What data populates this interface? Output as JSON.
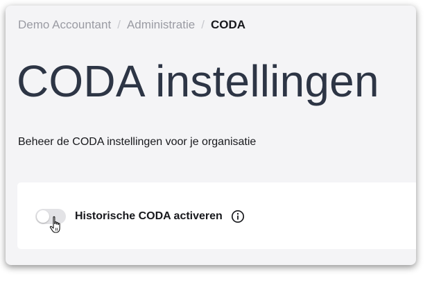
{
  "breadcrumb": {
    "items": [
      "Demo Accountant",
      "Administratie"
    ],
    "separator": "/",
    "current": "CODA"
  },
  "page": {
    "title": "CODA instellingen",
    "subtitle": "Beheer de CODA instellingen voor je organisatie"
  },
  "settings": {
    "historic_coda": {
      "label": "Historische CODA activeren",
      "enabled": false,
      "info_icon": "info-icon"
    }
  },
  "cursor": "hand-pointer-icon",
  "colors": {
    "title": "#2d3545",
    "muted": "#9a9ba3",
    "background": "#f4f4f6",
    "card": "#ffffff",
    "toggle_off": "#e3e3e6"
  }
}
